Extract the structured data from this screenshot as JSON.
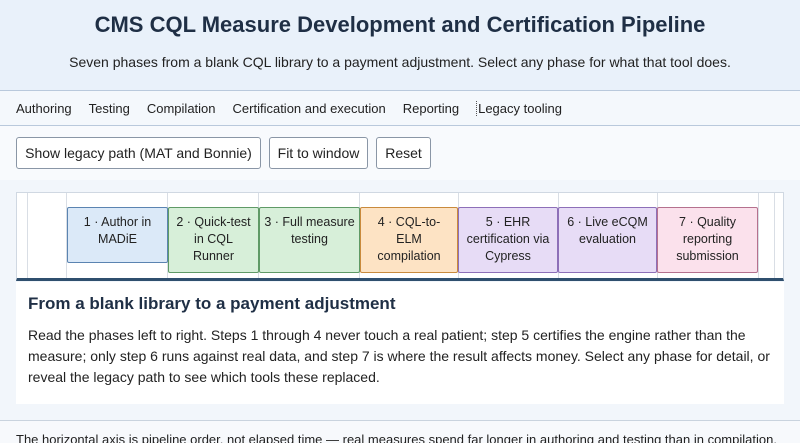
{
  "header": {
    "title": "CMS CQL Measure Development and Certification Pipeline",
    "subtitle": "Seven phases from a blank CQL library to a payment adjustment. Select any phase for what that tool does."
  },
  "nav": {
    "items": [
      {
        "label": "Authoring"
      },
      {
        "label": "Testing"
      },
      {
        "label": "Compilation"
      },
      {
        "label": "Certification and execution"
      },
      {
        "label": "Reporting"
      },
      {
        "label": "Legacy tooling"
      }
    ]
  },
  "controls": {
    "legacy_label": "Show legacy path (MAT and Bonnie)",
    "fit_label": "Fit to window",
    "reset_label": "Reset"
  },
  "phases": [
    {
      "label": "1 · Author in MADiE",
      "color": "#dbe9f8",
      "border": "#5b84b1"
    },
    {
      "label": "2 · Quick-test in CQL Runner",
      "color": "#d7efd9",
      "border": "#5f9a66"
    },
    {
      "label": "3 · Full measure testing",
      "color": "#d7efd9",
      "border": "#5f9a66"
    },
    {
      "label": "4 · CQL-to-ELM compilation",
      "color": "#fde3c4",
      "border": "#c98a3c"
    },
    {
      "label": "5 · EHR certification via Cypress",
      "color": "#e7dcf6",
      "border": "#8d6fb8"
    },
    {
      "label": "6 · Live eCQM evaluation",
      "color": "#e7dcf6",
      "border": "#8d6fb8"
    },
    {
      "label": "7 · Quality reporting submission",
      "color": "#fbe1ec",
      "border": "#b5718e"
    }
  ],
  "detail": {
    "title": "From a blank library to a payment adjustment",
    "body": "Read the phases left to right. Steps 1 through 4 never touch a real patient; step 5 certifies the engine rather than the measure; only step 6 runs against real data, and step 7 is where the result affects money. Select any phase for detail, or reveal the legacy path to see which tools these replaced."
  },
  "footnote": "The horizontal axis is pipeline order, not elapsed time — real measures spend far longer in authoring and testing than in compilation."
}
